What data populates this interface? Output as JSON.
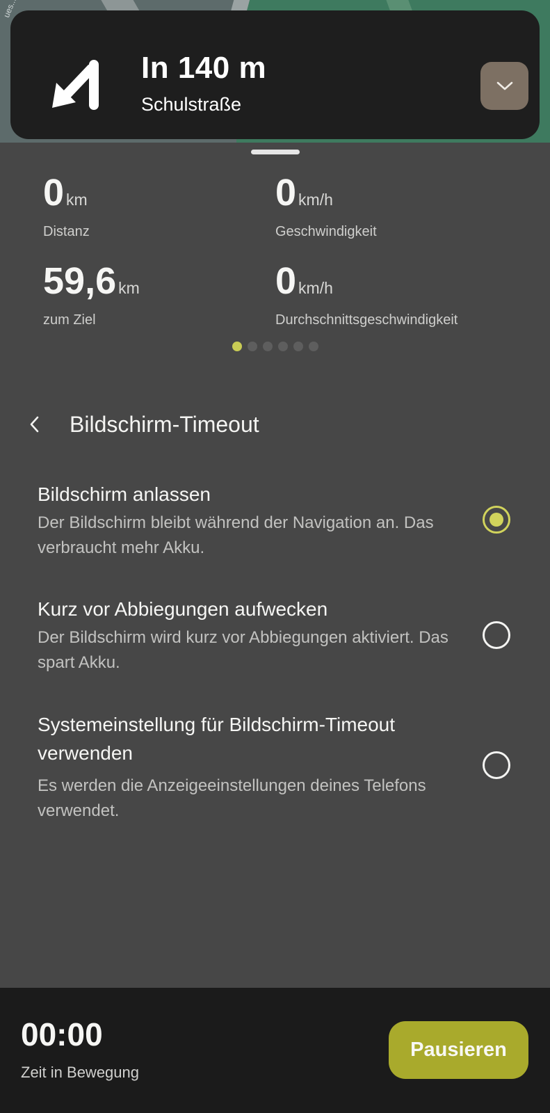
{
  "map": {
    "street_label_fragment": "ues..."
  },
  "navigation": {
    "distance": "In 140 m",
    "street": "Schulstraße",
    "turn_icon": "turn-sharp-left-icon",
    "collapse_icon": "chevron-down-icon"
  },
  "stats": {
    "distance": {
      "value": "0",
      "unit": "km",
      "label": "Distanz"
    },
    "speed": {
      "value": "0",
      "unit": "km/h",
      "label": "Geschwindigkeit"
    },
    "to_destination": {
      "value": "59,6",
      "unit": "km",
      "label": "zum Ziel"
    },
    "avg_speed": {
      "value": "0",
      "unit": "km/h",
      "label": "Durchschnittsgeschwindigkeit"
    },
    "pager": {
      "pages": 6,
      "active_index": 0
    }
  },
  "settings": {
    "title": "Bildschirm-Timeout",
    "options": [
      {
        "title": "Bildschirm anlassen",
        "description": "Der Bildschirm bleibt während der Navigation an. Das verbraucht mehr Akku.",
        "selected": true
      },
      {
        "title": "Kurz vor Abbiegungen aufwecken",
        "description": "Der Bildschirm wird kurz vor Abbiegungen aktiviert. Das spart Akku.",
        "selected": false
      },
      {
        "title": "Systemeinstellung für Bildschirm-Timeout verwenden",
        "description": "Es werden die Anzeigeeinstellungen deines Telefons verwendet.",
        "selected": false
      }
    ]
  },
  "bottom_bar": {
    "timer": "00:00",
    "timer_label": "Zeit in Bewegung",
    "pause_label": "Pausieren"
  },
  "colors": {
    "accent": "#d1d35c",
    "pause_button": "#a9aa2c",
    "sheet_background": "#474747",
    "banner_background": "#1e1e1e"
  }
}
